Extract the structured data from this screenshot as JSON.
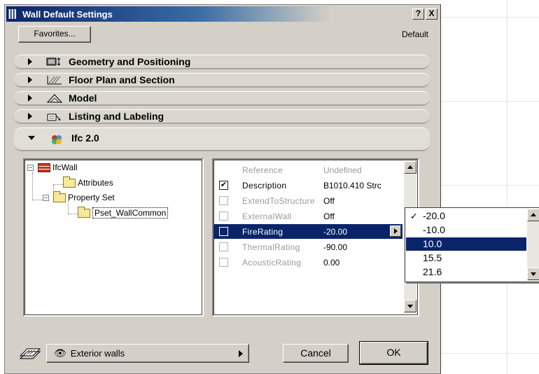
{
  "window": {
    "title": "Wall Default Settings",
    "help_label": "?",
    "close_label": "X"
  },
  "toolbar": {
    "favorites_label": "Favorites...",
    "default_label": "Default"
  },
  "panels": [
    {
      "label": "Geometry and Positioning",
      "icon": "geometry-icon"
    },
    {
      "label": "Floor Plan and Section",
      "icon": "floor-plan-icon"
    },
    {
      "label": "Model",
      "icon": "model-icon"
    },
    {
      "label": "Listing and Labeling",
      "icon": "listing-icon"
    },
    {
      "label": "Ifc 2.0",
      "icon": "ifc-icon"
    }
  ],
  "tree": {
    "root": "IfcWall",
    "attributes": "Attributes",
    "property_set": "Property Set",
    "pset": "Pset_WallCommon"
  },
  "properties": [
    {
      "name": "Reference",
      "value": "Undefined",
      "checked": false
    },
    {
      "name": "Description",
      "value": "B1010.410 Strc",
      "checked": true
    },
    {
      "name": "ExtendToStructure",
      "value": "Off",
      "checked": false
    },
    {
      "name": "ExternalWall",
      "value": "Off",
      "checked": false
    },
    {
      "name": "FireRating",
      "value": "-20.00",
      "checked": false
    },
    {
      "name": "ThermalRating",
      "value": "-90.00",
      "checked": false
    },
    {
      "name": "AcousticRating",
      "value": "0.00",
      "checked": false
    }
  ],
  "dropdown": {
    "options": [
      "-20.0",
      "-10.0",
      "10.0",
      "15.5",
      "21.6"
    ],
    "checked_index": 0,
    "highlighted_index": 2,
    "check_mark": "✓"
  },
  "footer": {
    "layer_label": "Exterior walls",
    "eye_glyph": "👁",
    "cancel_label": "Cancel",
    "ok_label": "OK"
  },
  "colors": {
    "titlebar": "#0a246a",
    "selection": "#0a246a",
    "dialog_bg": "#d4d0c8"
  }
}
